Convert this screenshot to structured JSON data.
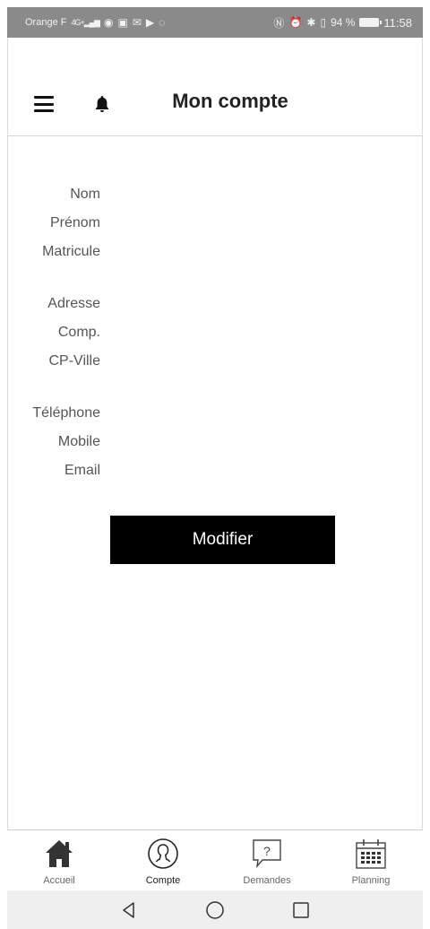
{
  "status_bar": {
    "carrier": "Orange F",
    "network": "4G+",
    "battery": "94 %",
    "time": "11:58",
    "left_icons": [
      "eye-icon",
      "cast-icon",
      "mail-icon",
      "youtube-icon",
      "whatsapp-icon"
    ],
    "right_icons": [
      "nfc-icon",
      "alarm-icon",
      "bluetooth-icon",
      "vibrate-icon",
      "battery-icon"
    ]
  },
  "header": {
    "title": "Mon compte",
    "menu_icon": "menu-icon",
    "notification_icon": "bell-icon"
  },
  "account": {
    "groups": [
      [
        "Nom",
        "Prénom",
        "Matricule"
      ],
      [
        "Adresse",
        "Comp.",
        "CP-Ville"
      ],
      [
        "Téléphone",
        "Mobile",
        "Email"
      ]
    ],
    "modify_label": "Modifier"
  },
  "bottom_nav": {
    "items": [
      {
        "label": "Accueil",
        "icon": "home-icon"
      },
      {
        "label": "Compte",
        "icon": "user-circle-icon",
        "active": true
      },
      {
        "label": "Demandes",
        "icon": "question-bubble-icon"
      },
      {
        "label": "Planning",
        "icon": "calendar-icon"
      }
    ]
  },
  "system_nav": [
    "back-icon",
    "home-circle-icon",
    "recents-icon"
  ]
}
